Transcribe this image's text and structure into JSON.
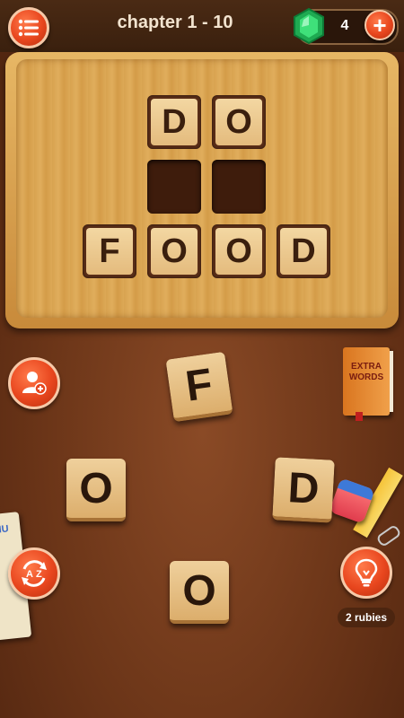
{
  "header": {
    "chapter_title": "chapter 1 - 10",
    "gem_count": "4",
    "plus_label": "+"
  },
  "board": {
    "row1": [
      "D",
      "O"
    ],
    "row2_empty_cells": 2,
    "row3": [
      "F",
      "O",
      "O",
      "D"
    ]
  },
  "tiles": [
    "F",
    "O",
    "D",
    "O"
  ],
  "extra_words": {
    "label_line1": "EXTRA",
    "label_line2": "WORDS"
  },
  "hint": {
    "cost_label": "2 rubies"
  },
  "icons": {
    "menu": "menu-list-icon",
    "gem": "emerald-gem-icon",
    "add_friend": "add-user-icon",
    "shuffle": "a-z-shuffle-icon",
    "hint": "lightbulb-icon"
  },
  "colors": {
    "accent_button": "#e8461e",
    "gem_green": "#2fd06a",
    "wood_board": "#dca856",
    "table_felt": "#6b3518"
  },
  "notepad": {
    "text": "MU"
  }
}
